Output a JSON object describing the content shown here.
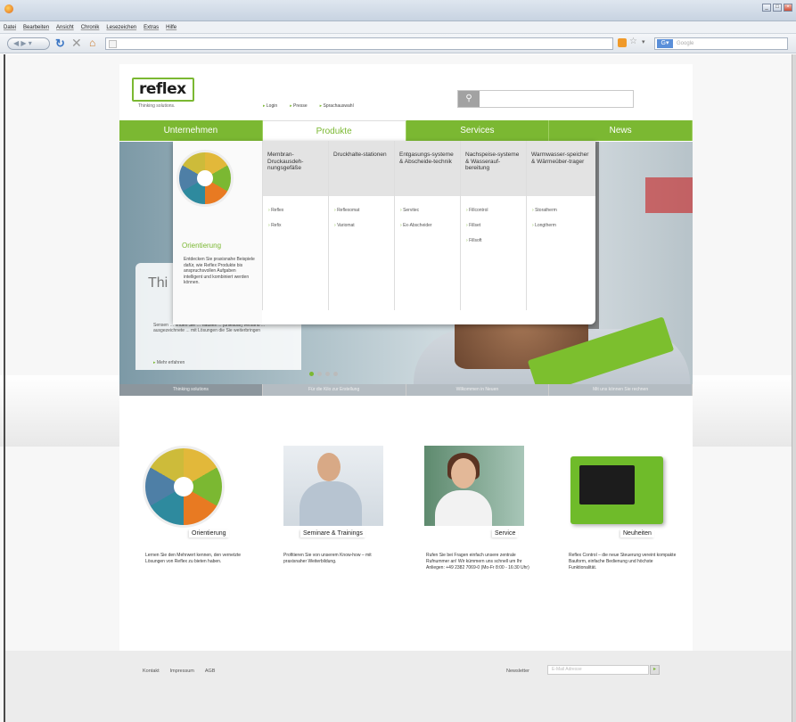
{
  "browser": {
    "menu": [
      "Datei",
      "Bearbeiten",
      "Ansicht",
      "Chronik",
      "Lesezeichen",
      "Extras",
      "Hilfe"
    ],
    "search_placeholder": "Google"
  },
  "site": {
    "tagline": "Thinking solutions.",
    "quicklinks": [
      "Login",
      "Presse",
      "Sprachauswahl"
    ],
    "nav": [
      "Unternehmen",
      "Produkte",
      "Services",
      "News"
    ],
    "hero_title": "Thi",
    "hero_text": "Sensen … finden Sie … hauses ... [unlesbar] Versand ... ausgezeichnete ... mit Lösungen die Sie weiterbringen",
    "hero_more": "Mehr erfahren",
    "slide_tabs": [
      "Thinking solutions",
      "Für die Kilo zur Erstellung",
      "Wilkommen in Neuen",
      "Mit uns können Sie rechnen"
    ]
  },
  "dropdown": {
    "orientation_title": "Orientierung",
    "orientation_text": "Entdecken Sie praxisnahe Beispiele dafür, wie Reflex Produkte bis anspruchsvollen Aufgaben intelligent und kombiniert werden können.",
    "columns": [
      {
        "head": "Membran-Druckausdeh-nungsgefäße",
        "items": [
          "Reflex",
          "Refix"
        ]
      },
      {
        "head": "Druckhalte-stationen",
        "items": [
          "Reflexomat",
          "Variomat"
        ]
      },
      {
        "head": "Entgasungs-systeme & Abscheide-technik",
        "items": [
          "Servitec",
          "Ex-Abscheider"
        ]
      },
      {
        "head": "Nachspeise-systeme & Wasserauf-bereitung",
        "items": [
          "Fillcontrol",
          "Fillset",
          "Fillsoft"
        ]
      },
      {
        "head": "Warmwasser-speicher & Wärmeüber-trager",
        "items": [
          "Storatherm",
          "Longtherm"
        ]
      }
    ]
  },
  "teasers": [
    {
      "label": "Orientierung",
      "text": "Lernen Sie den Mehrwert kennen, den vernetzte Lösungen von Reflex zu bieten haben."
    },
    {
      "label": "Seminare & Trainings",
      "text": "Profitieren Sie von unserem Know-how – mit praxisnaher Weiterbildung."
    },
    {
      "label": "Service",
      "text": "Rufen Sie bei Fragen einfach unsere zentrale Rufnummer an! Wir kümmern uns schnell um Ihr Anliegen: +49 2382 7069-0 (Mo-Fr 8:00 - 16:30 Uhr)"
    },
    {
      "label": "Neuheiten",
      "text": "Reflex Control – die neue Steuerung vereint kompakte Bauform, einfache Bedienung und höchste Funktionalität."
    }
  ],
  "footer": {
    "links": [
      "Kontakt",
      "Impressum",
      "AGB"
    ],
    "newsletter_label": "Newsletter",
    "newsletter_placeholder": "E-Mail Adresse"
  },
  "colors": {
    "brand_green": "#7bb832"
  }
}
